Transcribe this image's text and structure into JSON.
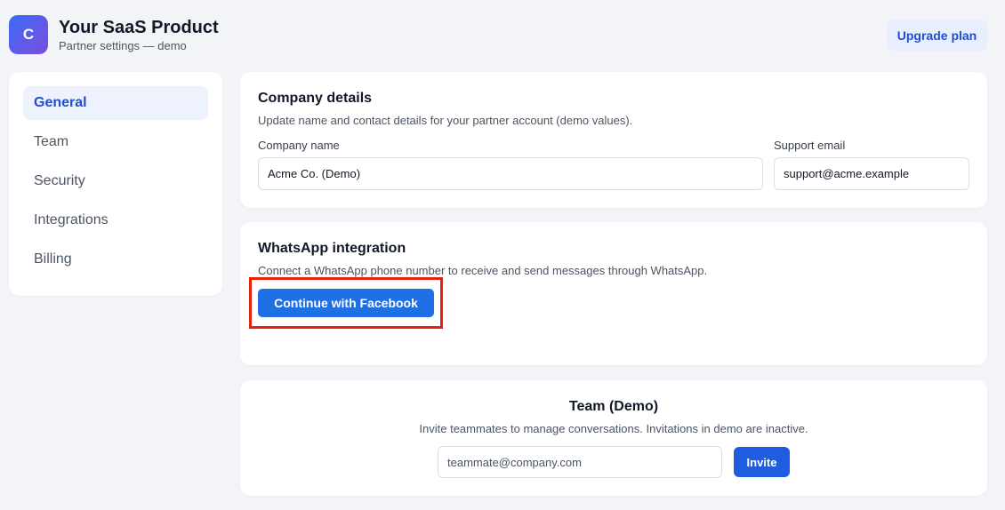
{
  "header": {
    "logo_letter": "C",
    "title": "Your SaaS Product",
    "subtitle": "Partner settings — demo",
    "upgrade_label": "Upgrade plan"
  },
  "sidebar": {
    "items": [
      {
        "label": "General",
        "active": true
      },
      {
        "label": "Team",
        "active": false
      },
      {
        "label": "Security",
        "active": false
      },
      {
        "label": "Integrations",
        "active": false
      },
      {
        "label": "Billing",
        "active": false
      }
    ]
  },
  "company": {
    "title": "Company details",
    "description": "Update name and contact details for your partner account (demo values).",
    "name_label": "Company name",
    "name_value": "Acme Co. (Demo)",
    "email_label": "Support email",
    "email_value": "support@acme.example"
  },
  "whatsapp": {
    "title": "WhatsApp integration",
    "description": "Connect a WhatsApp phone number to receive and send messages through WhatsApp.",
    "button_label": "Continue with Facebook"
  },
  "team": {
    "title": "Team (Demo)",
    "description": "Invite teammates to manage conversations. Invitations in demo are inactive.",
    "email_placeholder": "teammate@company.com",
    "invite_label": "Invite"
  },
  "colors": {
    "accent": "#1f6fe5",
    "highlight": "#e8200c",
    "background": "#f3f4f8"
  }
}
